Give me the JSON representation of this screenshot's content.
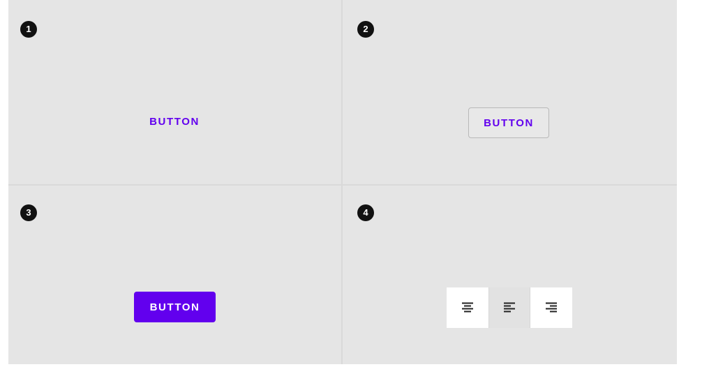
{
  "cells": [
    {
      "number": "1",
      "button_label": "BUTTON",
      "variant": "text"
    },
    {
      "number": "2",
      "button_label": "BUTTON",
      "variant": "outlined"
    },
    {
      "number": "3",
      "button_label": "BUTTON",
      "variant": "contained"
    },
    {
      "number": "4",
      "variant": "toggle-group",
      "toggles": [
        {
          "icon": "format-align-center-icon",
          "selected": false
        },
        {
          "icon": "format-align-left-icon",
          "selected": true
        },
        {
          "icon": "format-align-right-icon",
          "selected": false
        }
      ]
    }
  ],
  "colors": {
    "primary": "#6200ee",
    "panel_background": "#e5e5e5",
    "badge": "#111111"
  }
}
